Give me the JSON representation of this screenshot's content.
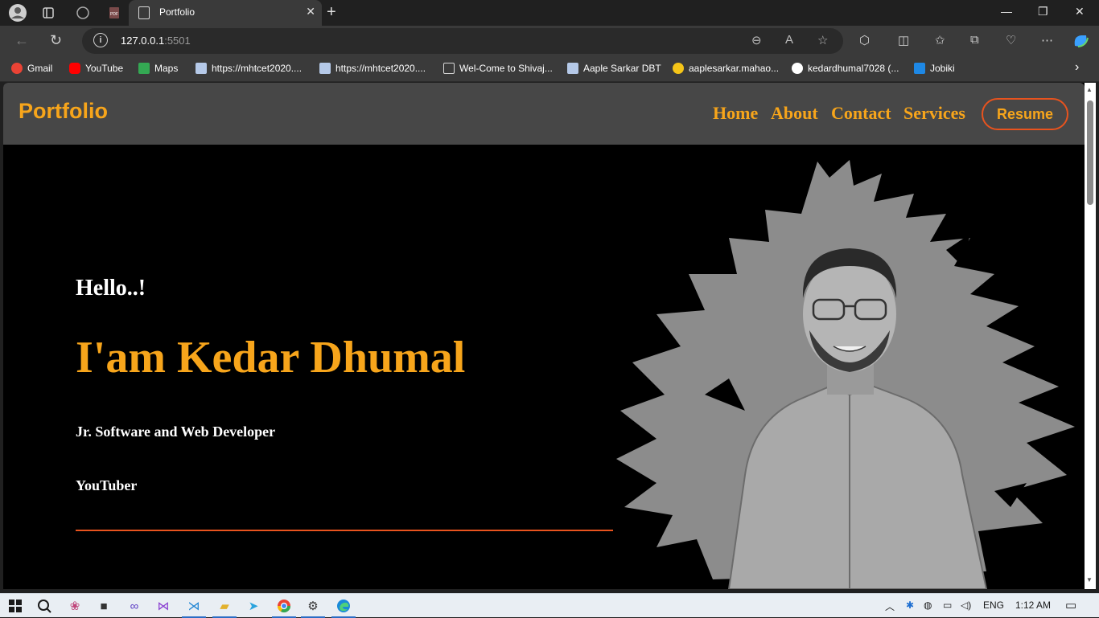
{
  "browser": {
    "tab_title": "Portfolio",
    "url_host": "127.0.0.1",
    "url_port": ":5501",
    "bookmarks": [
      {
        "label": "Gmail",
        "color": "#ea4335"
      },
      {
        "label": "YouTube",
        "color": "#ff0000"
      },
      {
        "label": "Maps",
        "color": "#34a853"
      },
      {
        "label": "https://mhtcet2020....",
        "color": "#b5c9e8"
      },
      {
        "label": "https://mhtcet2020....",
        "color": "#b5c9e8"
      },
      {
        "label": "Wel-Come to Shivaj...",
        "color": "#d8d8d8"
      },
      {
        "label": "Aaple Sarkar DBT",
        "color": "#b5c9e8"
      },
      {
        "label": "aaplesarkar.mahao...",
        "color": "#f5c518"
      },
      {
        "label": "kedardhumal7028 (...",
        "color": "#ffffff"
      },
      {
        "label": "Jobiki",
        "color": "#1e88e5"
      }
    ]
  },
  "site": {
    "logo": "Portfolio",
    "nav": [
      "Home",
      "About",
      "Contact",
      "Services"
    ],
    "resume_label": "Resume",
    "hello": "Hello..!",
    "name": "I'am Kedar Dhumal",
    "role": "Jr. Software and Web Developer",
    "secondary_role": "YouTuber",
    "accent_color": "#f7a51b",
    "line_color": "#e8531e"
  },
  "taskbar": {
    "language": "ENG",
    "time": "1:12 AM"
  }
}
